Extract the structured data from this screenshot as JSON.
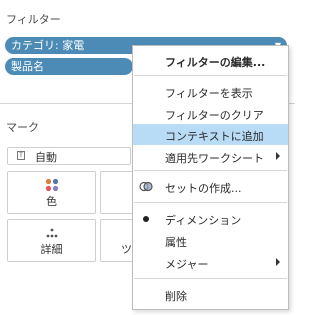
{
  "filters": {
    "title": "フィルター",
    "pills": [
      {
        "label": "カテゴリ: 家電"
      },
      {
        "label": "製品名"
      }
    ]
  },
  "marks": {
    "title": "マーク",
    "mark_type": "自動",
    "buttons": [
      {
        "label": "色",
        "icon": "color-dots-icon"
      },
      {
        "label": "詳細",
        "icon": "detail-dots-icon"
      },
      {
        "label": "ツ",
        "icon": "tooltip-icon"
      }
    ]
  },
  "context_menu": {
    "items": [
      {
        "label": "フィルターの編集...",
        "bold": true
      },
      {
        "label": "フィルターを表示"
      },
      {
        "label": "フィルターのクリア"
      },
      {
        "label": "コンテキストに追加",
        "highlighted": true
      },
      {
        "label": "適用先ワークシート",
        "submenu": true
      },
      {
        "label": "セットの作成...",
        "icon": "set-icon"
      },
      {
        "label": "ディメンション",
        "checked": true
      },
      {
        "label": "属性"
      },
      {
        "label": "メジャー",
        "submenu": true
      },
      {
        "label": "削除"
      }
    ]
  },
  "colors": {
    "pill": "#4b8bb5",
    "highlight": "#b9dcf6",
    "color_dots": [
      "#e07b39",
      "#4e79a7",
      "#e15759",
      "#8c7cc1"
    ]
  }
}
